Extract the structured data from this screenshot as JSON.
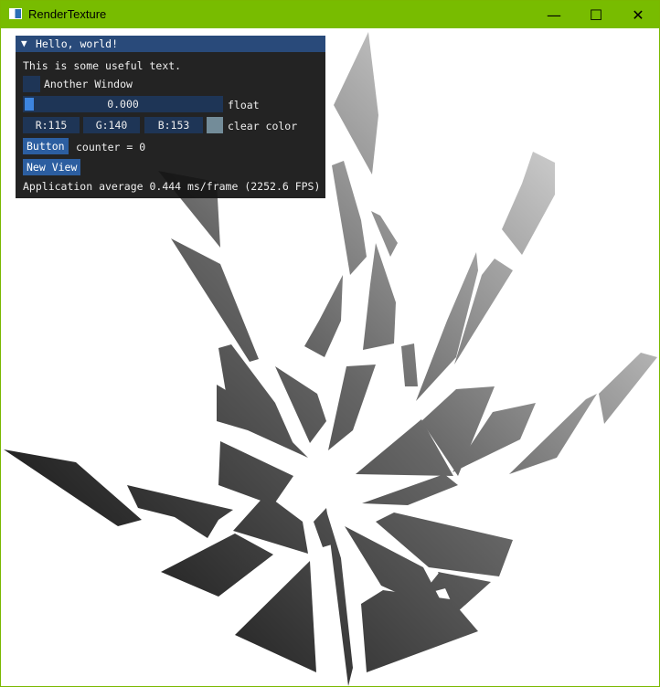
{
  "window": {
    "title": "RenderTexture",
    "border_color": "#7ab800",
    "titlebar_color": "#78bc00",
    "app_icon": "window-app-icon",
    "controls": {
      "minimize": "—",
      "maximize": "☐",
      "close": "✕"
    }
  },
  "imgui": {
    "panel_title": "Hello, world!",
    "collapse_arrow": "▼",
    "text": "This is some useful text.",
    "checkbox_label": "Another Window",
    "checkbox_checked": false,
    "slider_value": "0.000",
    "slider_fraction": 0.0,
    "slider_label": "float",
    "color_r": "R:115",
    "color_g": "G:140",
    "color_b": "B:153",
    "color_label": "clear color",
    "clear_color": "#738c99",
    "button_label": "Button",
    "counter_text": "counter = 0",
    "new_view_label": "New View",
    "fps_text": "Application average 0.444 ms/frame (2252.6 FPS)",
    "accent_colors": {
      "frame": "#1e3556",
      "button": "#2c5ea0",
      "header": "#294a7a",
      "grab": "#3d85e0"
    }
  }
}
